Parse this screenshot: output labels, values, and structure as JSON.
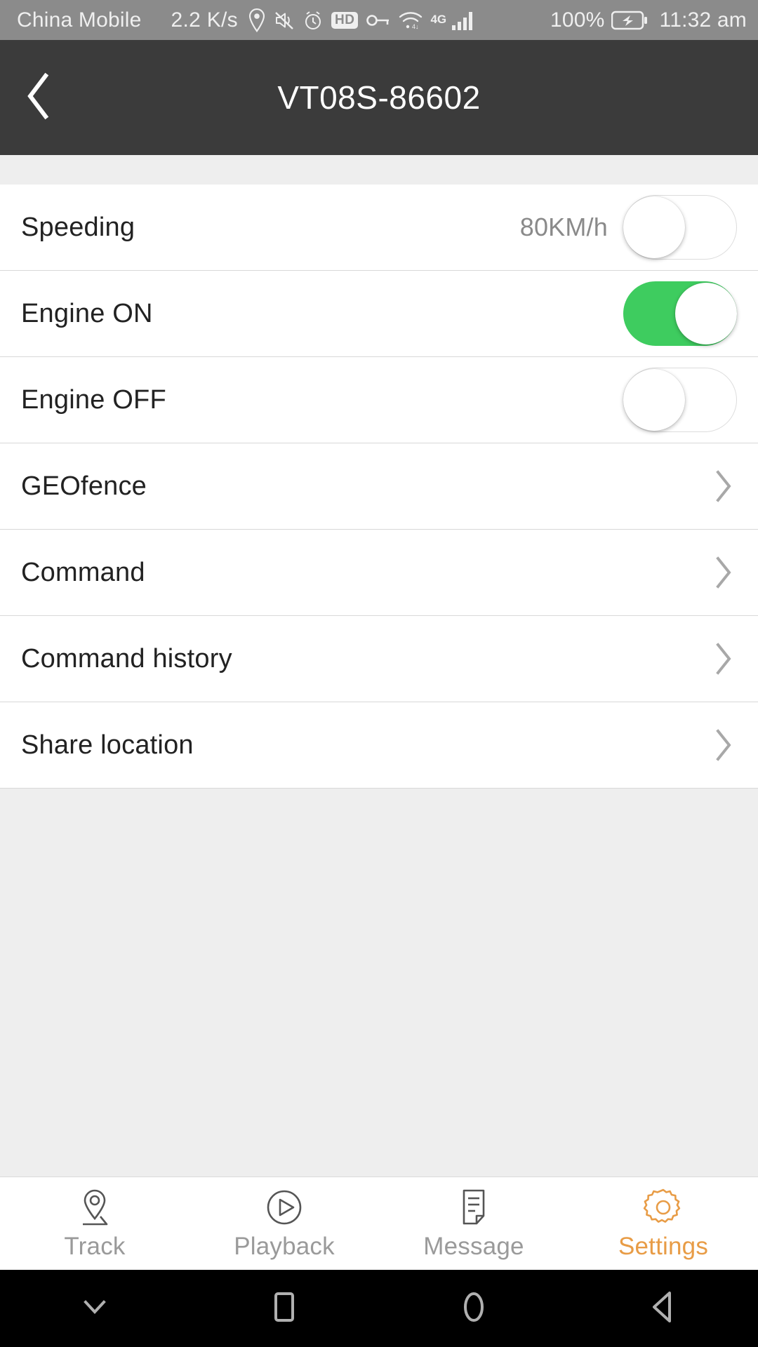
{
  "statusbar": {
    "carrier": "China Mobile",
    "net_speed": "2.2 K/s",
    "hd_badge": "HD",
    "network_type": "4G",
    "battery_percent": "100%",
    "time": "11:32 am",
    "icons": [
      "location-icon",
      "mute-icon",
      "alarm-icon",
      "hd-icon",
      "vpn-key-icon",
      "wifi-icon",
      "signal-icon",
      "battery-charging-icon"
    ]
  },
  "header": {
    "title": "VT08S-86602",
    "back_label": "Back"
  },
  "list": {
    "rows": [
      {
        "label": "Speeding",
        "type": "switch",
        "value": "80KM/h",
        "checked": false
      },
      {
        "label": "Engine ON",
        "type": "switch",
        "value": "",
        "checked": true
      },
      {
        "label": "Engine OFF",
        "type": "switch",
        "value": "",
        "checked": false
      },
      {
        "label": "GEOfence",
        "type": "chevron"
      },
      {
        "label": "Command",
        "type": "chevron"
      },
      {
        "label": "Command history",
        "type": "chevron"
      },
      {
        "label": "Share location",
        "type": "chevron"
      }
    ]
  },
  "tabbar": {
    "tabs": [
      {
        "label": "Track",
        "icon": "location-pin-icon",
        "active": false
      },
      {
        "label": "Playback",
        "icon": "play-circle-icon",
        "active": false
      },
      {
        "label": "Message",
        "icon": "document-icon",
        "active": false
      },
      {
        "label": "Settings",
        "icon": "gear-icon",
        "active": true
      }
    ]
  },
  "navbar": {
    "buttons": [
      {
        "name": "hide-keyboard-button",
        "icon": "chevron-down-icon"
      },
      {
        "name": "recents-button",
        "icon": "square-icon"
      },
      {
        "name": "home-button",
        "icon": "circle-icon"
      },
      {
        "name": "back-button",
        "icon": "triangle-left-icon"
      }
    ]
  },
  "colors": {
    "accent": "#e89c46",
    "switch_on": "#3ecc5f",
    "header_bg": "#3b3b3b",
    "statusbar_bg": "#8b8b8b"
  }
}
